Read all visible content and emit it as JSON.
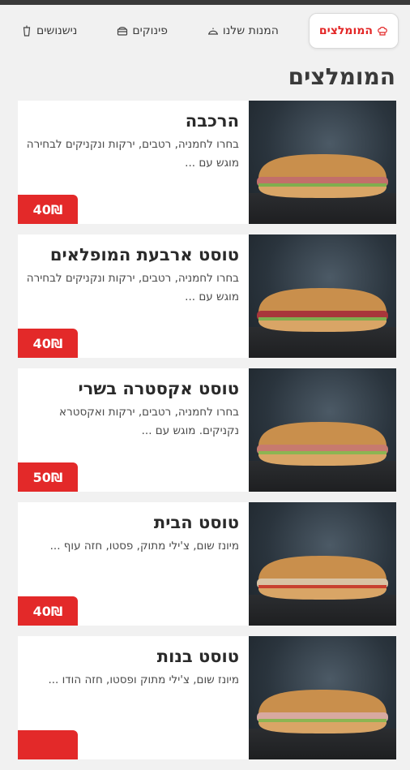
{
  "tabs": [
    {
      "label": "המומלצים",
      "icon": "chef-hat-icon",
      "active": true
    },
    {
      "label": "המנות שלנו",
      "icon": "cloche-icon",
      "active": false
    },
    {
      "label": "פינוקים",
      "icon": "dessert-icon",
      "active": false
    },
    {
      "label": "נישנושים",
      "icon": "cup-icon",
      "active": false
    }
  ],
  "section": {
    "title": "המומלצים"
  },
  "items": [
    {
      "name": "הרכבה",
      "desc": "בחרו לחמניה, רטבים, ירקות ונקניקים לבחירה מוגש עם ...",
      "price": "40₪"
    },
    {
      "name": "טוסט ארבעת המופלאים",
      "desc": "בחרו לחמניה, רטבים, ירקות ונקניקים לבחירה מוגש עם ...",
      "price": "40₪"
    },
    {
      "name": "טוסט אקסטרה בשרי",
      "desc": "בחרו לחמניה, רטבים, ירקות ואקסטרא נקניקים. מוגש עם ...",
      "price": "50₪"
    },
    {
      "name": "טוסט הבית",
      "desc": "מיונז שום, צ'ילי מתוק, פסטו, חזה עוף ...",
      "price": "40₪"
    },
    {
      "name": "טוסט בנות",
      "desc": "מיונז שום, צ'ילי מתוק ופסטו, חזה הודו ...",
      "price": ""
    }
  ],
  "colors": {
    "accent": "#e32929",
    "card_bg": "#ffffff",
    "page_bg": "#f1f1f1"
  }
}
